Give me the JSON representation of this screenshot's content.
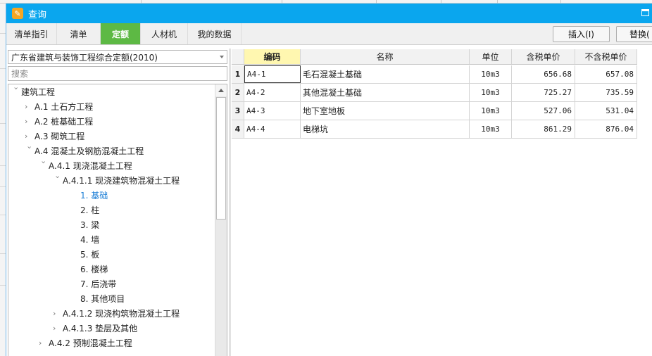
{
  "window": {
    "title": "查询",
    "icon": "app-logo-icon"
  },
  "tabs": [
    {
      "label": "清单指引",
      "active": false
    },
    {
      "label": "清单",
      "active": false
    },
    {
      "label": "定额",
      "active": true
    },
    {
      "label": "人材机",
      "active": false
    },
    {
      "label": "我的数据",
      "active": false
    }
  ],
  "toolbar": {
    "insert_label": "插入(I)",
    "replace_label": "替换("
  },
  "quota_library": {
    "selected": "广东省建筑与装饰工程综合定额(2010)"
  },
  "search": {
    "placeholder": "搜索",
    "value": ""
  },
  "tree": [
    {
      "label": "建筑工程",
      "expanded": true
    },
    {
      "label": "A.1 土石方工程",
      "expanded": false
    },
    {
      "label": "A.2 桩基础工程",
      "expanded": false
    },
    {
      "label": "A.3 砌筑工程",
      "expanded": false
    },
    {
      "label": "A.4 混凝土及钢筋混凝土工程",
      "expanded": true
    },
    {
      "label": "A.4.1 现浇混凝土工程",
      "expanded": true
    },
    {
      "label": "A.4.1.1 现浇建筑物混凝土工程",
      "expanded": true
    },
    {
      "label": "1. 基础",
      "selected": true
    },
    {
      "label": "2. 柱"
    },
    {
      "label": "3. 梁"
    },
    {
      "label": "4. 墙"
    },
    {
      "label": "5. 板"
    },
    {
      "label": "6. 楼梯"
    },
    {
      "label": "7. 后浇带"
    },
    {
      "label": "8. 其他项目"
    },
    {
      "label": "A.4.1.2 现浇构筑物混凝土工程",
      "expanded": false
    },
    {
      "label": "A.4.1.3 垫层及其他",
      "expanded": false
    },
    {
      "label": "A.4.2 预制混凝土工程",
      "expanded": false
    }
  ],
  "grid": {
    "columns": {
      "code": "编码",
      "name": "名称",
      "unit": "单位",
      "price_tax": "含税单价",
      "price_notax": "不含税单价"
    },
    "rows": [
      {
        "idx": "1",
        "code": "A4-1",
        "name": "毛石混凝土基础",
        "unit": "10m3",
        "price_tax": "656.68",
        "price_notax": "657.08"
      },
      {
        "idx": "2",
        "code": "A4-2",
        "name": "其他混凝土基础",
        "unit": "10m3",
        "price_tax": "725.27",
        "price_notax": "735.59"
      },
      {
        "idx": "3",
        "code": "A4-3",
        "name": "地下室地板",
        "unit": "10m3",
        "price_tax": "527.06",
        "price_notax": "531.04"
      },
      {
        "idx": "4",
        "code": "A4-4",
        "name": "电梯坑",
        "unit": "10m3",
        "price_tax": "861.29",
        "price_notax": "876.04"
      }
    ]
  },
  "colors": {
    "titlebar": "#0aa6ee",
    "active_tab": "#5db944",
    "selected_tree": "#1c7ed6",
    "sorted_header": "#fff7b0"
  }
}
